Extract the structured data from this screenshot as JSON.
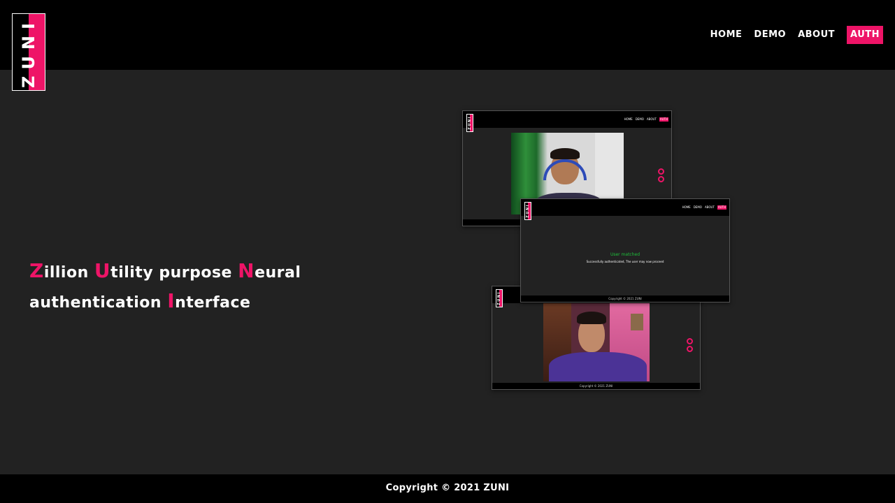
{
  "logo": {
    "text": "ZUNI"
  },
  "nav": {
    "items": [
      {
        "label": "HOME"
      },
      {
        "label": "DEMO"
      },
      {
        "label": "ABOUT"
      },
      {
        "label": "AUTH"
      }
    ],
    "active": "AUTH"
  },
  "headline": {
    "line1": [
      {
        "accent": "Z",
        "rest": "illion "
      },
      {
        "accent": "U",
        "rest": "tility purpose "
      },
      {
        "accent": "N",
        "rest": "eural"
      }
    ],
    "line2": [
      {
        "accent": "",
        "rest": "authentication "
      },
      {
        "accent": "I",
        "rest": "nterface"
      }
    ]
  },
  "previews": {
    "logo_text": "ZUNI",
    "nav": [
      "HOME",
      "DEMO",
      "ABOUT",
      "AUTH"
    ],
    "success": {
      "title": "User matched",
      "message": "Successfully authenticated, The user may now proceed",
      "footer": "Copyright © 2021 ZUNI"
    },
    "camera_footer": "Copyright © 2021 ZUNI"
  },
  "footer": {
    "copyright": "Copyright © 2021  ZUNI"
  },
  "colors": {
    "accent": "#ee1467",
    "header": "#000000",
    "background": "#222222",
    "success": "#1ec13b"
  }
}
